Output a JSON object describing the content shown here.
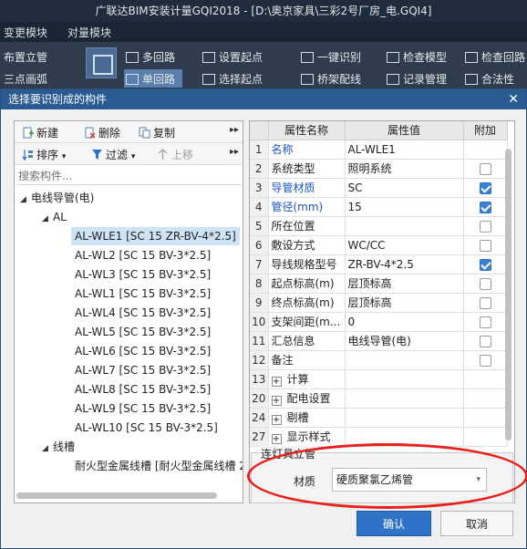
{
  "app": {
    "title": "广联达BIM安装计量GQI2018 - [D:\\奥京家具\\三彩2号厂房_电.GQI4]",
    "menu": [
      "变更模块",
      "对量模块"
    ],
    "ribbon": {
      "left_items": [
        "布置立管",
        "三点画弧"
      ],
      "items": [
        "多回路",
        "单回路",
        "设置起点",
        "选择起点",
        "一键识别",
        "桥架配线",
        "检查模型",
        "记录管理",
        "检查回路",
        "合法性"
      ]
    }
  },
  "dialog": {
    "title": "选择要识别成的构件",
    "close_glyph": "✕",
    "toolbar": {
      "new_label": "新建",
      "delete_label": "删除",
      "copy_label": "复制",
      "sort_label": "排序",
      "filter_label": "过滤",
      "up_label": "上移",
      "more_glyph": "▸▸"
    },
    "search": {
      "placeholder": "搜索构件..."
    },
    "tree": {
      "root": "电线导管(电)",
      "group_al": "AL",
      "items": [
        "AL-WLE1 [SC 15 ZR-BV-4*2.5]",
        "AL-WL2 [SC 15 BV-3*2.5]",
        "AL-WL3 [SC 15 BV-3*2.5]",
        "AL-WL1 [SC 15 BV-3*2.5]",
        "AL-WL4 [SC 15 BV-3*2.5]",
        "AL-WL5 [SC 15 BV-3*2.5]",
        "AL-WL6 [SC 15 BV-3*2.5]",
        "AL-WL7 [SC 15 BV-3*2.5]",
        "AL-WL8 [SC 15 BV-3*2.5]",
        "AL-WL9 [SC 15 BV-3*2.5]",
        "AL-WL10 [SC 15 BV-3*2.5]"
      ],
      "group_tray": "线槽",
      "tray_item": "耐火型金属线槽 [耐火型金属线槽 2"
    },
    "grid": {
      "headers": {
        "name": "属性名称",
        "value": "属性值",
        "extra": "附加"
      },
      "rows": [
        {
          "n": "1",
          "name": "名称",
          "value": "AL-WLE1",
          "blue": true,
          "cb": null
        },
        {
          "n": "2",
          "name": "系统类型",
          "value": "照明系统",
          "blue": false,
          "cb": false
        },
        {
          "n": "3",
          "name": "导管材质",
          "value": "SC",
          "blue": true,
          "cb": true
        },
        {
          "n": "4",
          "name": "管径(mm)",
          "value": "15",
          "blue": true,
          "cb": true
        },
        {
          "n": "5",
          "name": "所在位置",
          "value": "",
          "blue": false,
          "cb": false
        },
        {
          "n": "6",
          "name": "敷设方式",
          "value": "WC/CC",
          "blue": false,
          "cb": false
        },
        {
          "n": "7",
          "name": "导线规格型号",
          "value": "ZR-BV-4*2.5",
          "blue": false,
          "cb": true
        },
        {
          "n": "8",
          "name": "起点标高(m)",
          "value": "层顶标高",
          "blue": false,
          "cb": false
        },
        {
          "n": "9",
          "name": "终点标高(m)",
          "value": "层顶标高",
          "blue": false,
          "cb": false
        },
        {
          "n": "10",
          "name": "支架间距(m...",
          "value": "0",
          "blue": false,
          "cb": false
        },
        {
          "n": "11",
          "name": "汇总信息",
          "value": "电线导管(电)",
          "blue": false,
          "cb": false
        },
        {
          "n": "12",
          "name": "备注",
          "value": "",
          "blue": false,
          "cb": false
        },
        {
          "n": "13",
          "name": "计算",
          "value": "",
          "blue": false,
          "cb": null,
          "plus": true
        },
        {
          "n": "20",
          "name": "配电设置",
          "value": "",
          "blue": false,
          "cb": null,
          "plus": true
        },
        {
          "n": "24",
          "name": "剔槽",
          "value": "",
          "blue": false,
          "cb": null,
          "plus": true
        },
        {
          "n": "27",
          "name": "显示样式",
          "value": "",
          "blue": false,
          "cb": null,
          "plus": true
        }
      ]
    },
    "group": {
      "legend": "连灯具立管",
      "material_label": "材质",
      "material_value": "硬质聚氯乙烯管"
    },
    "ok_label": "确认",
    "cancel_label": "取消",
    "colors": {
      "accent": "#2f73c9",
      "titlebar": "#2a5a92",
      "highlight": "#e8201c"
    }
  }
}
